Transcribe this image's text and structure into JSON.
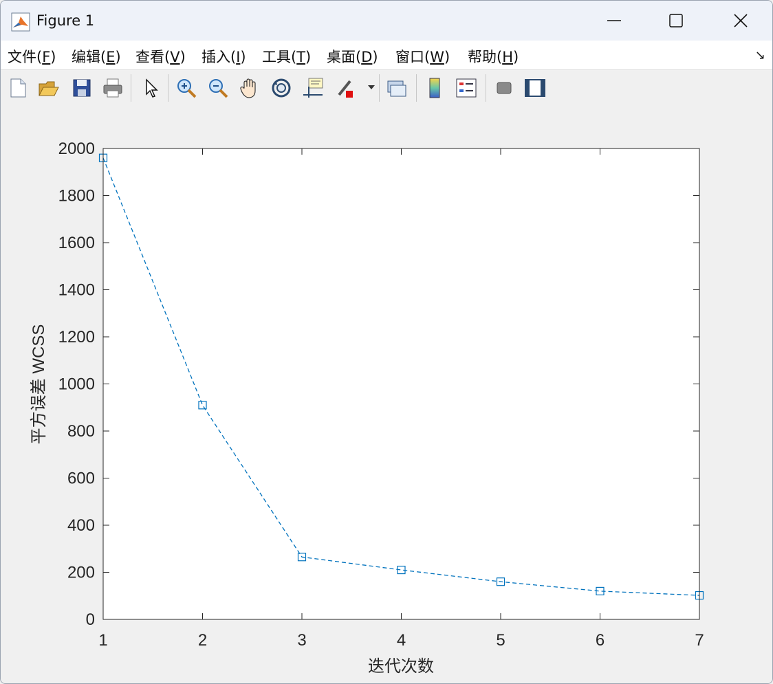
{
  "window": {
    "title": "Figure 1"
  },
  "menu": [
    {
      "label": "文件(",
      "key": "F",
      "tail": ")"
    },
    {
      "label": "编辑(",
      "key": "E",
      "tail": ")"
    },
    {
      "label": "查看(",
      "key": "V",
      "tail": ")"
    },
    {
      "label": "插入(",
      "key": "I",
      "tail": ")"
    },
    {
      "label": "工具(",
      "key": "T",
      "tail": ")"
    },
    {
      "label": "桌面(",
      "key": "D",
      "tail": ")"
    },
    {
      "label": "窗口(",
      "key": "W",
      "tail": ")"
    },
    {
      "label": "帮助(",
      "key": "H",
      "tail": ")"
    }
  ],
  "toolbar": [
    "new-figure-icon",
    "open-icon",
    "save-icon",
    "print-icon",
    "pointer-icon",
    "zoom-in-icon",
    "zoom-out-icon",
    "pan-icon",
    "rotate-icon",
    "data-cursor-icon",
    "brush-icon",
    "link-icon",
    "colorbar-icon",
    "legend-icon",
    "hide-plot-tools-icon",
    "show-plot-tools-icon"
  ],
  "chart_data": {
    "type": "line",
    "x": [
      1,
      2,
      3,
      4,
      5,
      6,
      7
    ],
    "series": [
      {
        "values": [
          1960,
          910,
          265,
          210,
          160,
          120,
          102
        ],
        "color": "#0072bd",
        "line_style": "dashed",
        "marker": "square"
      }
    ],
    "xlabel": "迭代次数",
    "ylabel": "平方误差 WCSS",
    "xlim": [
      1,
      7
    ],
    "ylim": [
      0,
      2000
    ],
    "xticks": [
      "1",
      "2",
      "3",
      "4",
      "5",
      "6",
      "7"
    ],
    "yticks": [
      "0",
      "200",
      "400",
      "600",
      "800",
      "1000",
      "1200",
      "1400",
      "1600",
      "1800",
      "2000"
    ],
    "grid": false
  }
}
